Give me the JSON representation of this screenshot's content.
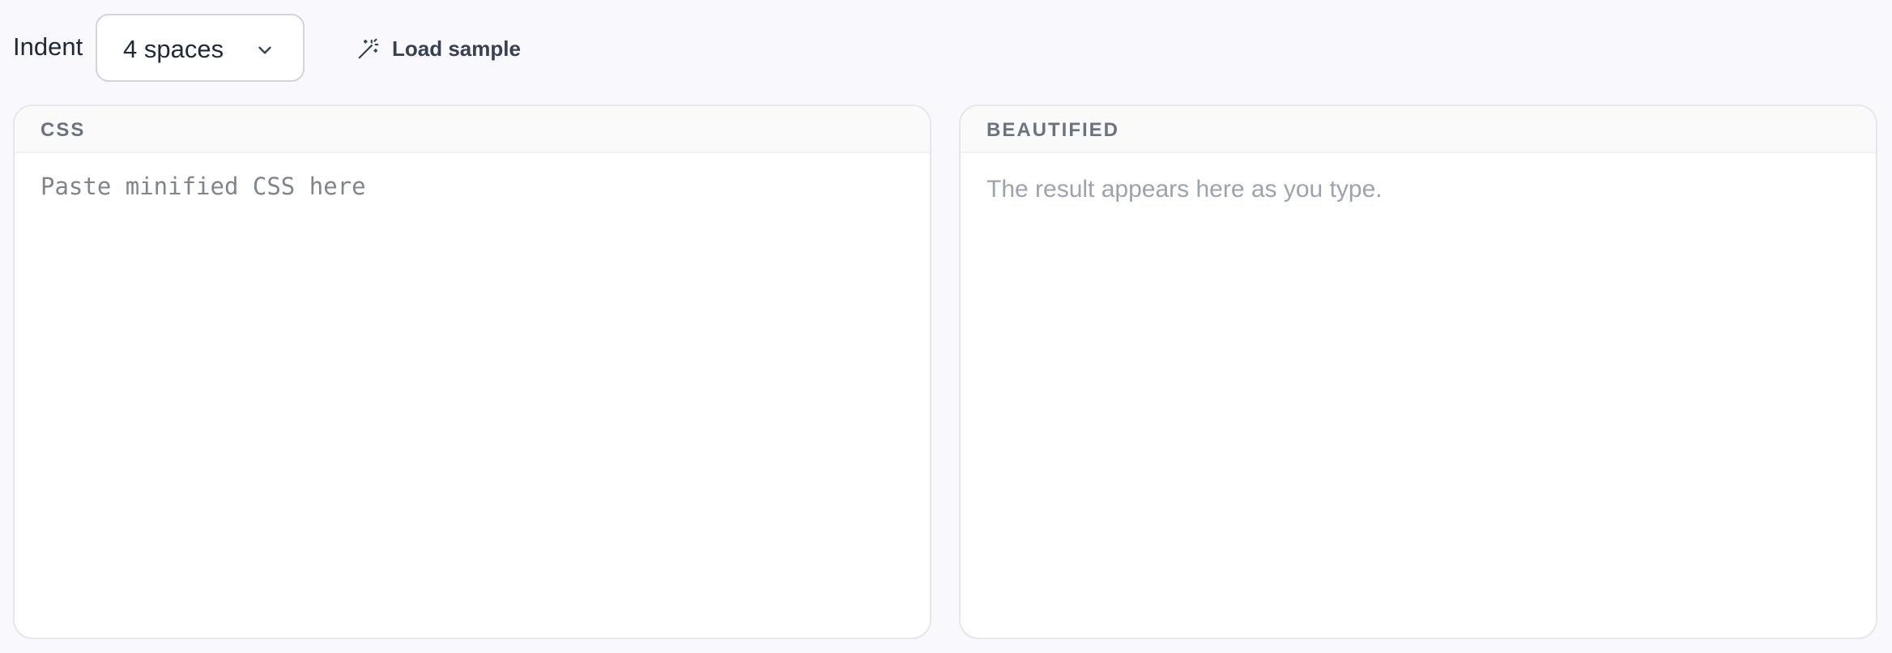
{
  "toolbar": {
    "indent_label": "Indent",
    "indent_select": {
      "selected": "4 spaces",
      "icon": "chevron-down-icon"
    },
    "load_sample": {
      "label": "Load sample",
      "icon": "magic-wand-icon"
    }
  },
  "input_panel": {
    "title": "CSS",
    "value": "",
    "placeholder": "Paste minified CSS here"
  },
  "output_panel": {
    "title": "BEAUTIFIED",
    "placeholder": "The result appears here as you type."
  },
  "colors": {
    "page_background": "#f8f8fd",
    "panel_border": "#e5e7eb",
    "header_text": "#6b7280",
    "placeholder_text": "#9ca3af"
  }
}
